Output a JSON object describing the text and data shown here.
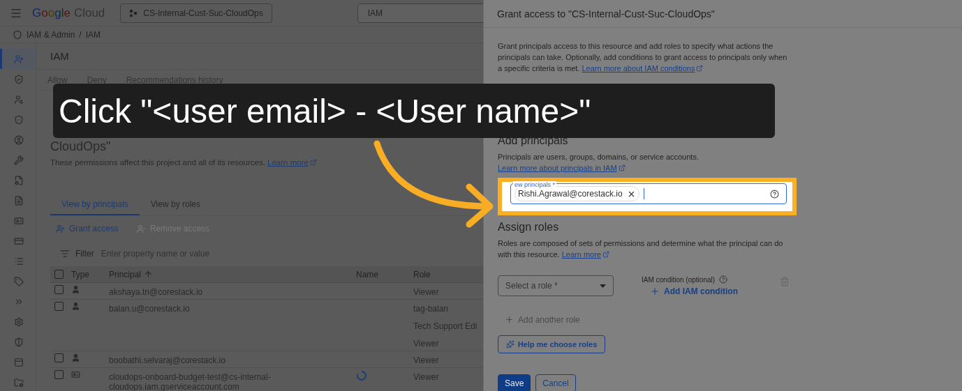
{
  "top_bar": {
    "logo": {
      "brand": "Google",
      "product": "Cloud"
    },
    "project": "CS-Internal-Cust-Suc-CloudOps",
    "search": {
      "value": "IAM"
    }
  },
  "breadcrumb": {
    "items": [
      "IAM & Admin",
      "IAM"
    ],
    "separator": "/"
  },
  "sidebar": {
    "items": [
      {
        "kind": "add-user",
        "selected": true
      },
      {
        "kind": "shield",
        "selected": false
      },
      {
        "kind": "user-search",
        "selected": false
      },
      {
        "kind": "shield-dots",
        "selected": false
      },
      {
        "kind": "account",
        "selected": false
      },
      {
        "kind": "wrench",
        "selected": false
      },
      {
        "kind": "file-gear",
        "selected": false
      },
      {
        "kind": "document",
        "selected": false
      },
      {
        "kind": "id-card",
        "selected": false
      },
      {
        "kind": "card",
        "selected": false
      },
      {
        "kind": "list",
        "selected": false
      },
      {
        "kind": "tag",
        "selected": false
      },
      {
        "kind": "chevrons",
        "selected": false
      },
      {
        "kind": "gear",
        "selected": false
      },
      {
        "kind": "shield-half",
        "selected": false
      },
      {
        "kind": "panel",
        "selected": false
      },
      {
        "kind": "folder-gear",
        "selected": false
      }
    ]
  },
  "page": {
    "title": "IAM",
    "policy_tabs": [
      "Allow",
      "Deny",
      "Recommendations history"
    ],
    "heading_tail": "CloudOps\"",
    "description": "These permissions affect this project and all of its resources.",
    "description_link": "Learn more",
    "view_tabs": [
      {
        "label": "View by principals",
        "selected": true
      },
      {
        "label": "View by roles",
        "selected": false
      }
    ],
    "actions": [
      {
        "label": "Grant access",
        "kind": "add",
        "disabled": false
      },
      {
        "label": "Remove access",
        "kind": "remove",
        "disabled": true
      }
    ],
    "filter": {
      "label": "Filter",
      "placeholder": "Enter property name or value"
    },
    "table": {
      "columns": [
        "Type",
        "Principal",
        "Name",
        "Role"
      ],
      "select_all_checked": false,
      "rows": [
        {
          "kind": "user",
          "checked": false,
          "principal": "akshaya.tn@corestack.io",
          "loading": false,
          "roles": [
            "Viewer"
          ]
        },
        {
          "kind": "user",
          "checked": false,
          "principal": "balan.u@corestack.io",
          "loading": false,
          "roles": [
            "tag-balan",
            "Tech Support Edi",
            "Viewer"
          ]
        },
        {
          "kind": "user",
          "checked": false,
          "principal": "boobathi.selvaraj@corestack.io",
          "loading": false,
          "roles": [
            "Viewer"
          ]
        },
        {
          "kind": "service-account",
          "checked": false,
          "principal": "cloudops-onboard-budget-test@cs-internal-cloudops.iam.gserviceaccount.com",
          "loading": true,
          "roles": [
            "Viewer"
          ]
        }
      ]
    }
  },
  "dialog": {
    "title": "Grant access to \"CS-Internal-Cust-Suc-CloudOps\"",
    "intro": "Grant principals access to this resource and add roles to specify what actions the principals can take. Optionally, add conditions to grant access to principals only when a specific criteria is met.",
    "intro_link": "Learn more about IAM conditions",
    "add_principals": {
      "heading": "Add principals",
      "text": "Principals are users, groups, domains, or service accounts.",
      "link": "Learn more about principals in IAM",
      "field": {
        "label": "ew principals *",
        "chips": [
          "Rishi.Agrawal@corestack.io"
        ]
      }
    },
    "assign_roles": {
      "heading": "Assign roles",
      "text": "Roles are composed of sets of permissions and determine what the principal can do with this resource.",
      "link": "Learn more",
      "role_select": {
        "placeholder": "Select a role *"
      },
      "condition_label": "IAM condition (optional)",
      "add_condition": "Add IAM condition",
      "add_another": {
        "label": "Add another role",
        "disabled": true
      },
      "help_button": "Help me choose roles"
    },
    "buttons": [
      {
        "label": "Save",
        "kind": "primary"
      },
      {
        "label": "Cancel",
        "kind": "secondary"
      }
    ]
  },
  "overlay": {
    "banner": "Click \"<user email> - <User name>\""
  }
}
